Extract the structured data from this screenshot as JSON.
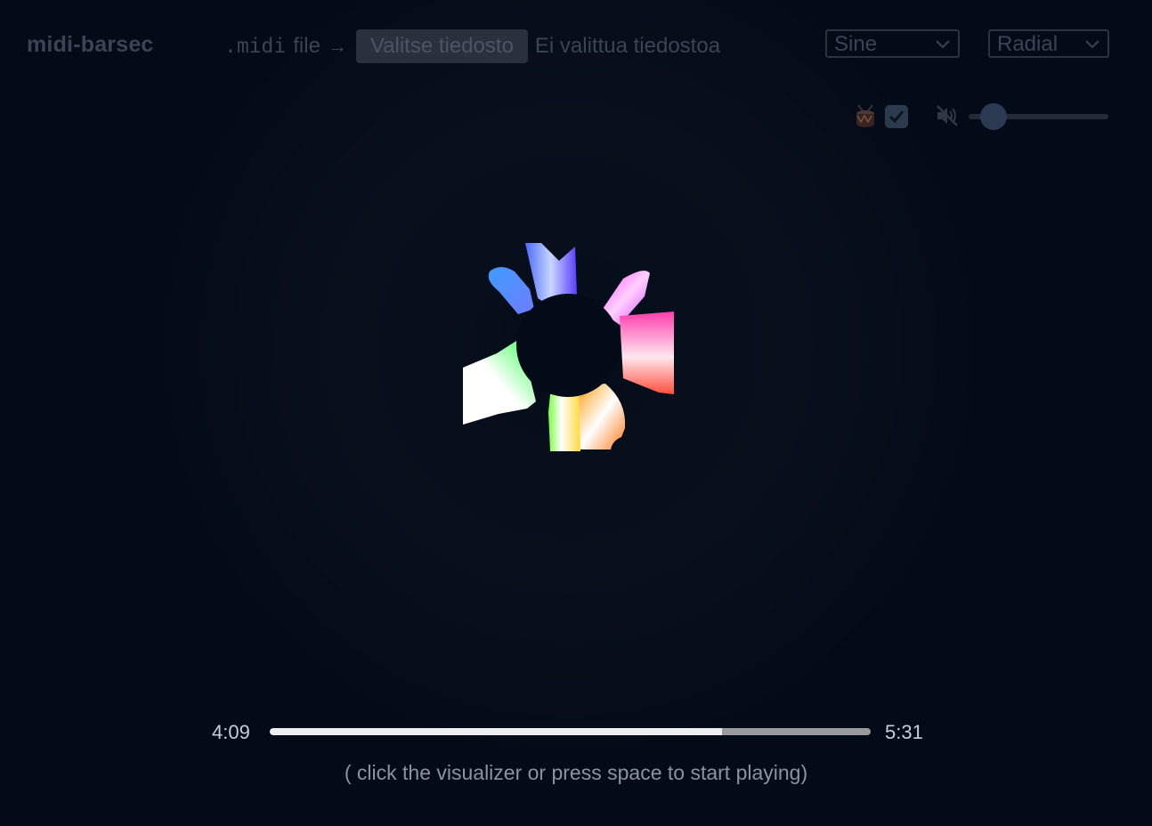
{
  "header": {
    "brand": "midi-barsec",
    "file_ext": ".midi",
    "file_word": "file",
    "arrow": "→",
    "file_button_label": "Valitse tiedosto",
    "file_status": "Ei valittua tiedostoa",
    "waveform_select_value": "Sine",
    "mode_select_value": "Radial"
  },
  "controls": {
    "drums_enabled": true,
    "volume_muted_icon": "speaker-muted-icon",
    "volume_level": 0.1
  },
  "player": {
    "current_time": "4:09",
    "total_time": "5:31",
    "progress": 0.752,
    "hint": "( click the visualizer or press space to start playing)"
  },
  "colors": {
    "background": "#040b18",
    "muted_text": "#3b4354",
    "progress_fill": "#eeeeee",
    "progress_track": "#9a9a9a"
  }
}
